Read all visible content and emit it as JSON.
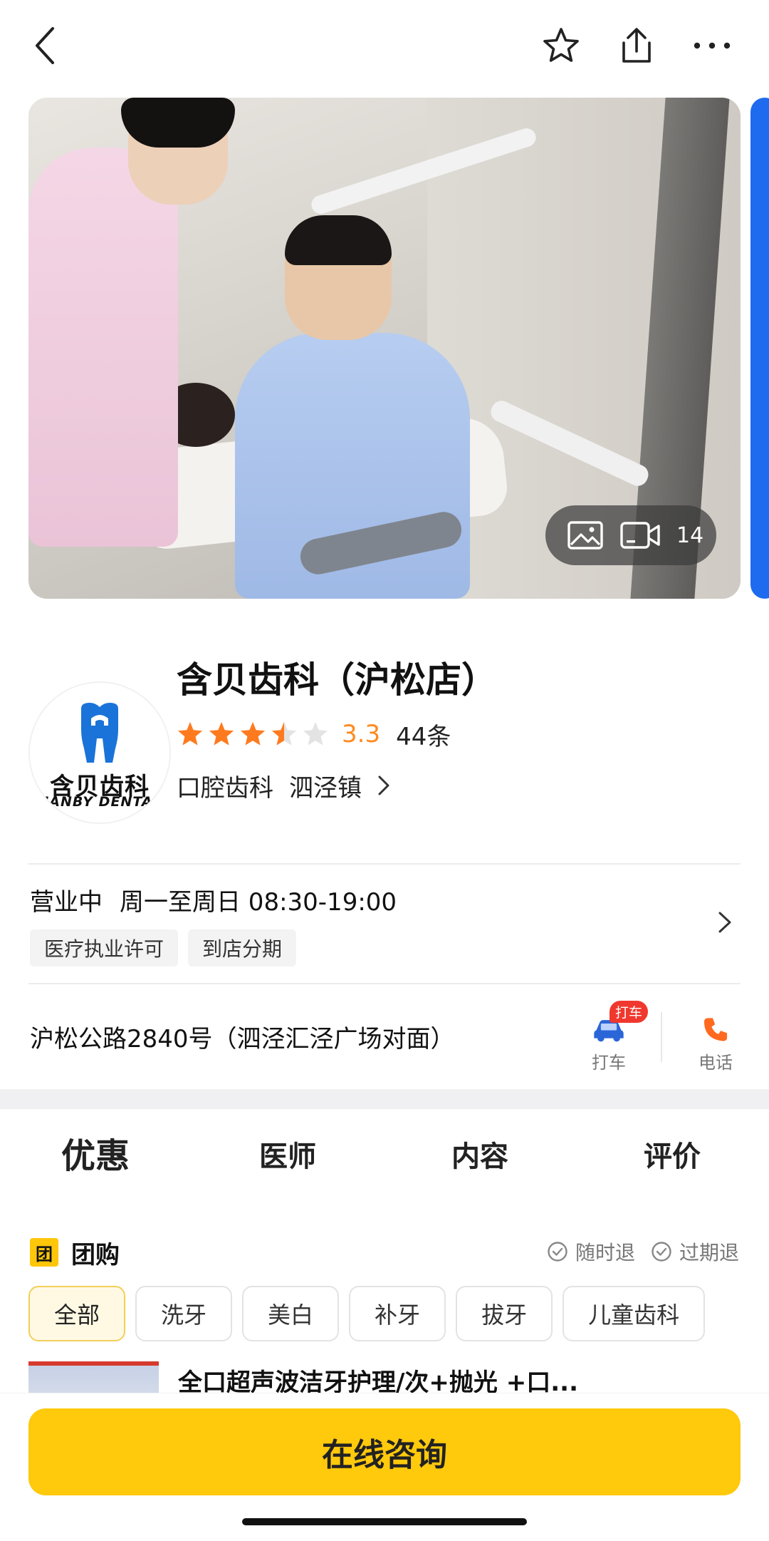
{
  "header": {
    "back_icon": "chevron-left-icon",
    "favorite_icon": "star-outline-icon",
    "share_icon": "share-icon",
    "more_icon": "more-horizontal-icon"
  },
  "gallery": {
    "media_count": "14",
    "photo_icon": "image-icon",
    "video_icon": "video-icon",
    "peek_color": "#1e6bf0"
  },
  "shop": {
    "logo_text_cn": "含贝齿科",
    "logo_text_en": "HANBY DENTAL",
    "name": "含贝齿科（沪松店）",
    "rating": 3.5,
    "score": "3.3",
    "review_count": "44条",
    "category": "口腔齿科",
    "area": "泗泾镇"
  },
  "business": {
    "status": "营业中",
    "hours": "周一至周日 08:30-19:00",
    "tags": [
      "医疗执业许可",
      "到店分期"
    ]
  },
  "location": {
    "address": "沪松公路2840号（泗泾汇泾广场对面）",
    "taxi_badge": "打车",
    "taxi_label": "打车",
    "phone_label": "电话"
  },
  "tabs": [
    "优惠",
    "医师",
    "内容",
    "评价"
  ],
  "group_buy": {
    "icon_text": "团",
    "title": "团购",
    "guarantees": [
      "随时退",
      "过期退"
    ],
    "filters": [
      "全部",
      "洗牙",
      "美白",
      "补牙",
      "拔牙",
      "儿童齿科"
    ],
    "first_deal_title": "全口超声波洁牙护理/次+抛光 +口..."
  },
  "cta": {
    "label": "在线咨询"
  },
  "colors": {
    "accent": "#ffc90c",
    "star": "#ff7a1f",
    "score": "#ff8a1f"
  }
}
